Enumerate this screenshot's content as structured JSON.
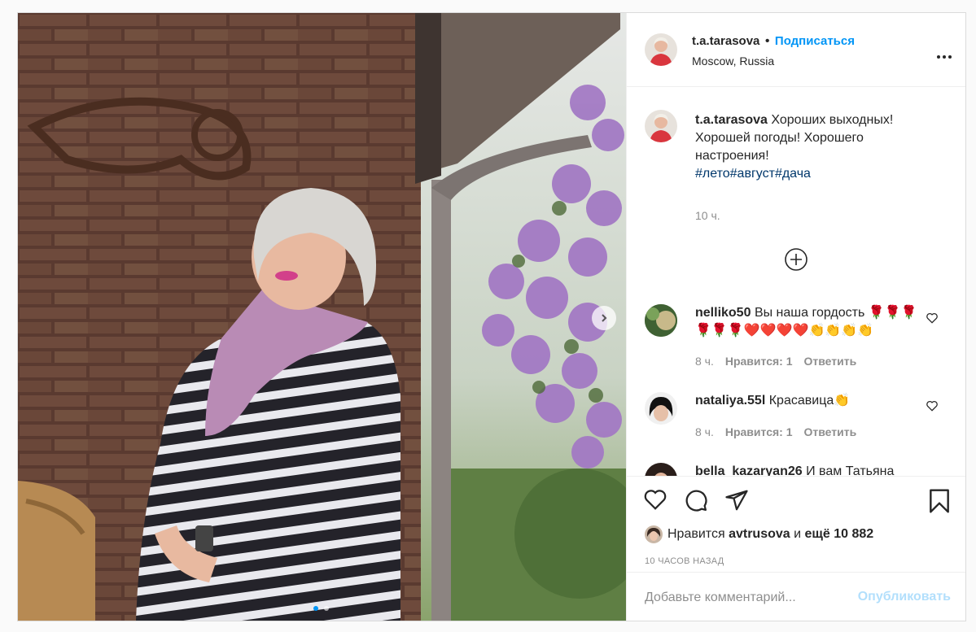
{
  "post": {
    "username": "t.a.tarasova",
    "follow_dot": "•",
    "follow_label": "Подписаться",
    "location": "Moscow, Russia",
    "caption_username": "t.a.tarasova",
    "caption_text": "Хороших выходных! Хорошей погоды! Хорошего настроения!",
    "hashtags": [
      "#лето",
      "#август",
      "#дача"
    ],
    "caption_time": "10 ч.",
    "comments": [
      {
        "username": "nelliko50",
        "text": "Вы наша гордость 🌹🌹🌹🌹🌹🌹❤️❤️❤️❤️👏👏👏👏",
        "time": "8 ч.",
        "likes": "Нравится: 1",
        "reply": "Ответить"
      },
      {
        "username": "nataliya.55l",
        "text": "Красавица👏",
        "time": "8 ч.",
        "likes": "Нравится: 1",
        "reply": "Ответить"
      },
      {
        "username": "bella_kazaryan26",
        "text": "И вам Татьяна"
      }
    ],
    "liked_by_prefix": "Нравится",
    "liked_by_user": "avtrusova",
    "liked_by_and": "и",
    "liked_by_more": "ещё 10 882",
    "timestamp": "10 ЧАСОВ НАЗАД",
    "comment_placeholder": "Добавьте комментарий...",
    "publish_label": "Опубликовать"
  },
  "icons": {
    "more": "more-options-icon",
    "load_more": "plus-circle-icon",
    "like": "heart-icon",
    "comment": "comment-icon",
    "share": "share-icon",
    "save": "bookmark-icon",
    "next": "chevron-right-icon"
  },
  "colors": {
    "accent": "#0095f6",
    "hashtag": "#00376b",
    "muted": "#8e8e8e",
    "publish_disabled": "#b2dffc"
  }
}
